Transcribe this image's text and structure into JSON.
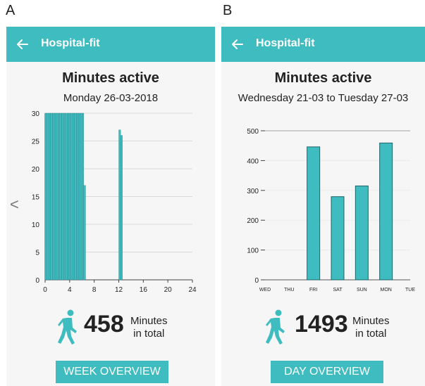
{
  "panels": [
    {
      "letter": "A",
      "appbar_title": "Hospital-fit",
      "title": "Minutes active",
      "subtitle": "Monday 26-03-2018",
      "prev_arrow": "<",
      "total": "458",
      "unit_line1": "Minutes",
      "unit_line2": "in total",
      "button": "WEEK OVERVIEW",
      "accent_color": "#3fbcc0"
    },
    {
      "letter": "B",
      "appbar_title": "Hospital-fit",
      "title": "Minutes active",
      "subtitle": "Wednesday 21-03 to Tuesday 27-03",
      "total": "1493",
      "unit_line1": "Minutes",
      "unit_line2": "in total",
      "button": "DAY OVERVIEW",
      "accent_color": "#3fbcc0"
    }
  ],
  "chart_data": [
    {
      "type": "bar",
      "x_ticks": [
        0,
        4,
        8,
        12,
        16,
        20,
        24
      ],
      "y_ticks": [
        0,
        5,
        10,
        15,
        20,
        25,
        30
      ],
      "xlim": [
        0,
        24
      ],
      "ylim": [
        0,
        30
      ],
      "bars": [
        {
          "x": 0.15,
          "y": 30
        },
        {
          "x": 0.45,
          "y": 30
        },
        {
          "x": 0.75,
          "y": 30
        },
        {
          "x": 1.05,
          "y": 30
        },
        {
          "x": 1.35,
          "y": 30
        },
        {
          "x": 1.65,
          "y": 30
        },
        {
          "x": 1.95,
          "y": 30
        },
        {
          "x": 2.25,
          "y": 30
        },
        {
          "x": 2.55,
          "y": 30
        },
        {
          "x": 2.85,
          "y": 30
        },
        {
          "x": 3.15,
          "y": 30
        },
        {
          "x": 3.45,
          "y": 30
        },
        {
          "x": 3.75,
          "y": 30
        },
        {
          "x": 4.05,
          "y": 30
        },
        {
          "x": 4.35,
          "y": 30
        },
        {
          "x": 4.65,
          "y": 30
        },
        {
          "x": 4.95,
          "y": 30
        },
        {
          "x": 5.25,
          "y": 30
        },
        {
          "x": 5.55,
          "y": 30
        },
        {
          "x": 5.85,
          "y": 30
        },
        {
          "x": 6.15,
          "y": 30
        },
        {
          "x": 6.45,
          "y": 17
        },
        {
          "x": 12.15,
          "y": 27
        },
        {
          "x": 12.45,
          "y": 26
        }
      ],
      "bar_width": 0.3,
      "grid": true
    },
    {
      "type": "bar",
      "categories": [
        "WED",
        "THU",
        "FRI",
        "SAT",
        "SUN",
        "MON",
        "TUE"
      ],
      "values": [
        0,
        0,
        446,
        279,
        315,
        459,
        0
      ],
      "y_ticks": [
        0,
        100,
        200,
        300,
        400,
        500
      ],
      "ylim": [
        0,
        500
      ],
      "grid": true
    }
  ]
}
